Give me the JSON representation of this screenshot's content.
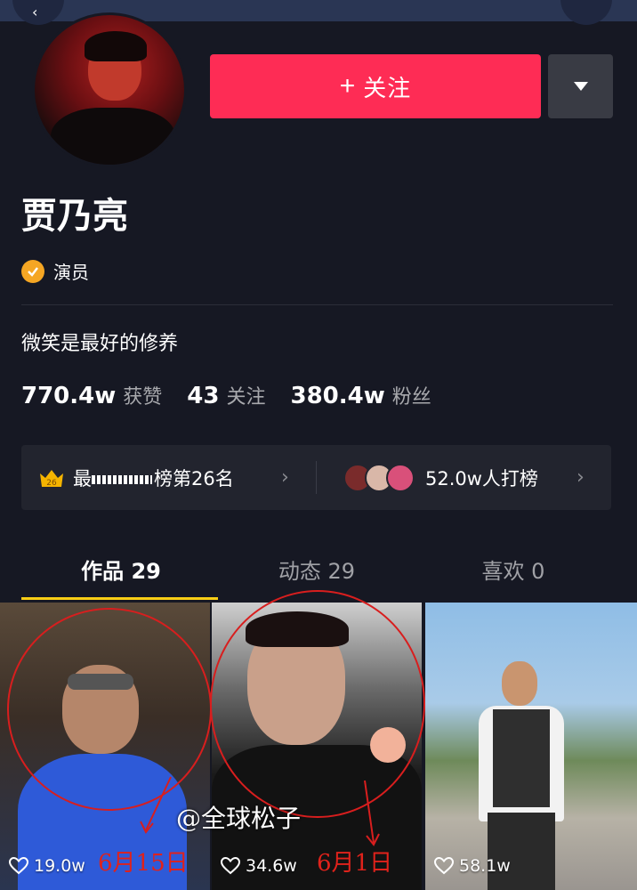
{
  "profile": {
    "name": "贾乃亮",
    "verification": "演员",
    "bio": "微笑是最好的修养"
  },
  "actions": {
    "follow_label": "关注",
    "follow_plus": "+"
  },
  "stats": [
    {
      "value": "770.4w",
      "label": "获赞"
    },
    {
      "value": "43",
      "label": "关注"
    },
    {
      "value": "380.4w",
      "label": "粉丝"
    }
  ],
  "rank": {
    "badge": "26",
    "prefix_char": "最",
    "suffix": "榜第26名",
    "supporters": "52.0w人打榜"
  },
  "tabs": [
    {
      "label": "作品 29"
    },
    {
      "label": "动态 29"
    },
    {
      "label": "喜欢 0"
    }
  ],
  "videos": [
    {
      "likes": "19.0w",
      "annotation": "6月15日"
    },
    {
      "likes": "34.6w",
      "annotation": "6月1日"
    },
    {
      "likes": "58.1w",
      "annotation": ""
    }
  ],
  "watermark": "@全球松子",
  "colors": {
    "background": "#161823",
    "follow_button": "#fe2c55",
    "active_tab_underline": "#face15",
    "verify_badge": "#f5a623",
    "annotation_red": "#d81e1e"
  },
  "icons": [
    "back-icon",
    "dropdown-triangle-icon",
    "plus-icon",
    "verified-check-icon",
    "crown-icon",
    "chevron-right-icon",
    "heart-outline-icon"
  ]
}
